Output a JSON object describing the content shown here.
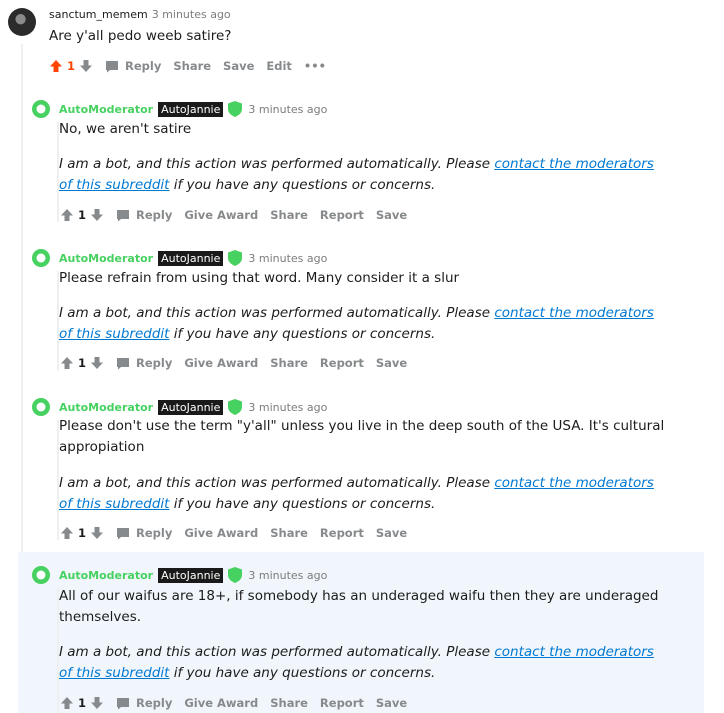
{
  "parent": {
    "author": "sanctum_memem",
    "time": "3 minutes ago",
    "body": "Are y'all pedo weeb satire?",
    "score": "1",
    "actions": {
      "reply": "Reply",
      "share": "Share",
      "save": "Save",
      "edit": "Edit",
      "more": "•••"
    }
  },
  "bot_note": {
    "before": "I am a bot, and this action was performed automatically. Please ",
    "link": "contact the moderators of this subreddit",
    "after": " if you have any questions or concerns."
  },
  "replies": [
    {
      "author": "AutoModerator",
      "flair": "AutoJannie",
      "time": "3 minutes ago",
      "body": "No, we aren't satire",
      "score": "1"
    },
    {
      "author": "AutoModerator",
      "flair": "AutoJannie",
      "time": "3 minutes ago",
      "body": "Please refrain from using that word. Many consider it a slur",
      "score": "1"
    },
    {
      "author": "AutoModerator",
      "flair": "AutoJannie",
      "time": "3 minutes ago",
      "body": "Please don't use the term \"y'all\" unless you live in the deep south of the USA. It's cultural appropiation",
      "score": "1"
    },
    {
      "author": "AutoModerator",
      "flair": "AutoJannie",
      "time": "3 minutes ago",
      "body": "All of our waifus are 18+, if somebody has an underaged waifu then they are underaged themselves.",
      "score": "1"
    }
  ],
  "reply_actions": {
    "reply": "Reply",
    "award": "Give Award",
    "share": "Share",
    "report": "Report",
    "save": "Save"
  },
  "colors": {
    "upvote": "#ff4500",
    "mod_green": "#46d160",
    "link": "#0079d3"
  }
}
